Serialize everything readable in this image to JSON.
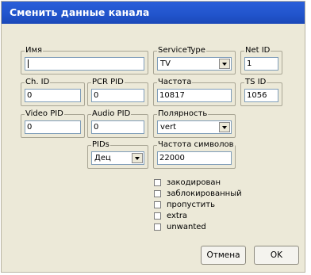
{
  "window": {
    "title": "Сменить данные канала"
  },
  "fields": {
    "name": {
      "label": "Имя",
      "value": ""
    },
    "service_type": {
      "label": "ServiceType",
      "value": "TV"
    },
    "net_id": {
      "label": "Net ID",
      "value": "1"
    },
    "ch_id": {
      "label": "Ch. ID",
      "value": "0"
    },
    "pcr_pid": {
      "label": "PCR PID",
      "value": "0"
    },
    "frequency": {
      "label": "Частота",
      "value": "10817"
    },
    "ts_id": {
      "label": "TS ID",
      "value": "1056"
    },
    "video_pid": {
      "label": "Video PID",
      "value": "0"
    },
    "audio_pid": {
      "label": "Audio PID",
      "value": "0"
    },
    "polarity": {
      "label": "Полярность",
      "value": "vert"
    },
    "pids": {
      "label": "PIDs",
      "value": "Дец"
    },
    "symbol_rate": {
      "label": "Частота символов",
      "value": "22000"
    }
  },
  "checkboxes": [
    {
      "label": "закодирован",
      "checked": false
    },
    {
      "label": "заблокированный",
      "checked": false
    },
    {
      "label": "пропустить",
      "checked": false
    },
    {
      "label": "extra",
      "checked": false
    },
    {
      "label": "unwanted",
      "checked": false
    }
  ],
  "buttons": {
    "cancel": "Отмена",
    "ok": "OK"
  }
}
